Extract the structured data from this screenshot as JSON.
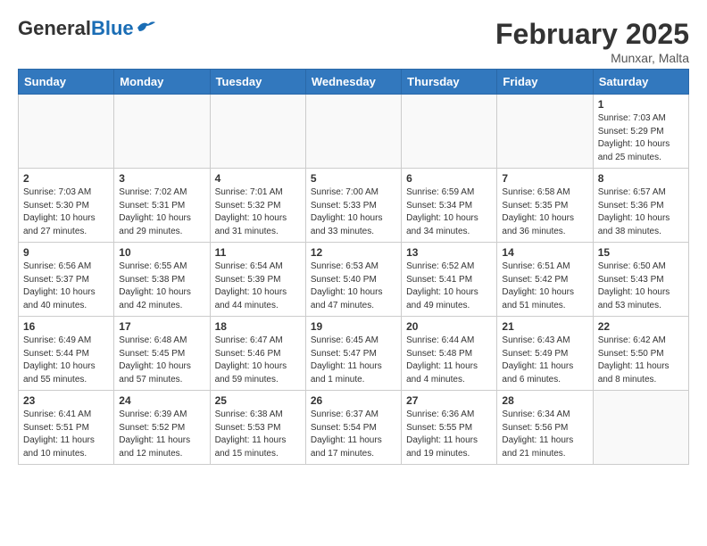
{
  "header": {
    "logo_line1": "General",
    "logo_line2": "Blue",
    "month": "February 2025",
    "location": "Munxar, Malta"
  },
  "weekdays": [
    "Sunday",
    "Monday",
    "Tuesday",
    "Wednesday",
    "Thursday",
    "Friday",
    "Saturday"
  ],
  "weeks": [
    [
      {
        "day": "",
        "info": ""
      },
      {
        "day": "",
        "info": ""
      },
      {
        "day": "",
        "info": ""
      },
      {
        "day": "",
        "info": ""
      },
      {
        "day": "",
        "info": ""
      },
      {
        "day": "",
        "info": ""
      },
      {
        "day": "1",
        "info": "Sunrise: 7:03 AM\nSunset: 5:29 PM\nDaylight: 10 hours\nand 25 minutes."
      }
    ],
    [
      {
        "day": "2",
        "info": "Sunrise: 7:03 AM\nSunset: 5:30 PM\nDaylight: 10 hours\nand 27 minutes."
      },
      {
        "day": "3",
        "info": "Sunrise: 7:02 AM\nSunset: 5:31 PM\nDaylight: 10 hours\nand 29 minutes."
      },
      {
        "day": "4",
        "info": "Sunrise: 7:01 AM\nSunset: 5:32 PM\nDaylight: 10 hours\nand 31 minutes."
      },
      {
        "day": "5",
        "info": "Sunrise: 7:00 AM\nSunset: 5:33 PM\nDaylight: 10 hours\nand 33 minutes."
      },
      {
        "day": "6",
        "info": "Sunrise: 6:59 AM\nSunset: 5:34 PM\nDaylight: 10 hours\nand 34 minutes."
      },
      {
        "day": "7",
        "info": "Sunrise: 6:58 AM\nSunset: 5:35 PM\nDaylight: 10 hours\nand 36 minutes."
      },
      {
        "day": "8",
        "info": "Sunrise: 6:57 AM\nSunset: 5:36 PM\nDaylight: 10 hours\nand 38 minutes."
      }
    ],
    [
      {
        "day": "9",
        "info": "Sunrise: 6:56 AM\nSunset: 5:37 PM\nDaylight: 10 hours\nand 40 minutes."
      },
      {
        "day": "10",
        "info": "Sunrise: 6:55 AM\nSunset: 5:38 PM\nDaylight: 10 hours\nand 42 minutes."
      },
      {
        "day": "11",
        "info": "Sunrise: 6:54 AM\nSunset: 5:39 PM\nDaylight: 10 hours\nand 44 minutes."
      },
      {
        "day": "12",
        "info": "Sunrise: 6:53 AM\nSunset: 5:40 PM\nDaylight: 10 hours\nand 47 minutes."
      },
      {
        "day": "13",
        "info": "Sunrise: 6:52 AM\nSunset: 5:41 PM\nDaylight: 10 hours\nand 49 minutes."
      },
      {
        "day": "14",
        "info": "Sunrise: 6:51 AM\nSunset: 5:42 PM\nDaylight: 10 hours\nand 51 minutes."
      },
      {
        "day": "15",
        "info": "Sunrise: 6:50 AM\nSunset: 5:43 PM\nDaylight: 10 hours\nand 53 minutes."
      }
    ],
    [
      {
        "day": "16",
        "info": "Sunrise: 6:49 AM\nSunset: 5:44 PM\nDaylight: 10 hours\nand 55 minutes."
      },
      {
        "day": "17",
        "info": "Sunrise: 6:48 AM\nSunset: 5:45 PM\nDaylight: 10 hours\nand 57 minutes."
      },
      {
        "day": "18",
        "info": "Sunrise: 6:47 AM\nSunset: 5:46 PM\nDaylight: 10 hours\nand 59 minutes."
      },
      {
        "day": "19",
        "info": "Sunrise: 6:45 AM\nSunset: 5:47 PM\nDaylight: 11 hours\nand 1 minute."
      },
      {
        "day": "20",
        "info": "Sunrise: 6:44 AM\nSunset: 5:48 PM\nDaylight: 11 hours\nand 4 minutes."
      },
      {
        "day": "21",
        "info": "Sunrise: 6:43 AM\nSunset: 5:49 PM\nDaylight: 11 hours\nand 6 minutes."
      },
      {
        "day": "22",
        "info": "Sunrise: 6:42 AM\nSunset: 5:50 PM\nDaylight: 11 hours\nand 8 minutes."
      }
    ],
    [
      {
        "day": "23",
        "info": "Sunrise: 6:41 AM\nSunset: 5:51 PM\nDaylight: 11 hours\nand 10 minutes."
      },
      {
        "day": "24",
        "info": "Sunrise: 6:39 AM\nSunset: 5:52 PM\nDaylight: 11 hours\nand 12 minutes."
      },
      {
        "day": "25",
        "info": "Sunrise: 6:38 AM\nSunset: 5:53 PM\nDaylight: 11 hours\nand 15 minutes."
      },
      {
        "day": "26",
        "info": "Sunrise: 6:37 AM\nSunset: 5:54 PM\nDaylight: 11 hours\nand 17 minutes."
      },
      {
        "day": "27",
        "info": "Sunrise: 6:36 AM\nSunset: 5:55 PM\nDaylight: 11 hours\nand 19 minutes."
      },
      {
        "day": "28",
        "info": "Sunrise: 6:34 AM\nSunset: 5:56 PM\nDaylight: 11 hours\nand 21 minutes."
      },
      {
        "day": "",
        "info": ""
      }
    ]
  ]
}
